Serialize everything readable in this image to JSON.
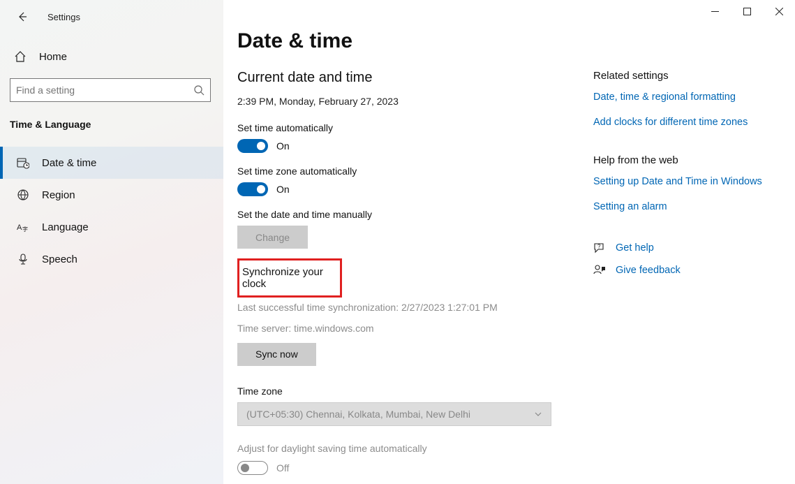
{
  "app": {
    "title": "Settings"
  },
  "sidebar": {
    "home_label": "Home",
    "search_placeholder": "Find a setting",
    "category": "Time & Language",
    "items": [
      {
        "label": "Date & time"
      },
      {
        "label": "Region"
      },
      {
        "label": "Language"
      },
      {
        "label": "Speech"
      }
    ]
  },
  "page": {
    "title": "Date & time",
    "current_heading": "Current date and time",
    "current_value": "2:39 PM, Monday, February 27, 2023",
    "set_time_auto_label": "Set time automatically",
    "set_time_auto_state": "On",
    "set_tz_auto_label": "Set time zone automatically",
    "set_tz_auto_state": "On",
    "manual_label": "Set the date and time manually",
    "change_btn": "Change",
    "sync_heading": "Synchronize your clock",
    "sync_last": "Last successful time synchronization: 2/27/2023 1:27:01 PM",
    "sync_server": "Time server: time.windows.com",
    "sync_btn": "Sync now",
    "tz_label": "Time zone",
    "tz_value": "(UTC+05:30) Chennai, Kolkata, Mumbai, New Delhi",
    "dst_label": "Adjust for daylight saving time automatically",
    "dst_state": "Off"
  },
  "right": {
    "related_heading": "Related settings",
    "link_formatting": "Date, time & regional formatting",
    "link_clocks": "Add clocks for different time zones",
    "help_heading": "Help from the web",
    "link_setup": "Setting up Date and Time in Windows",
    "link_alarm": "Setting an alarm",
    "get_help": "Get help",
    "feedback": "Give feedback"
  }
}
